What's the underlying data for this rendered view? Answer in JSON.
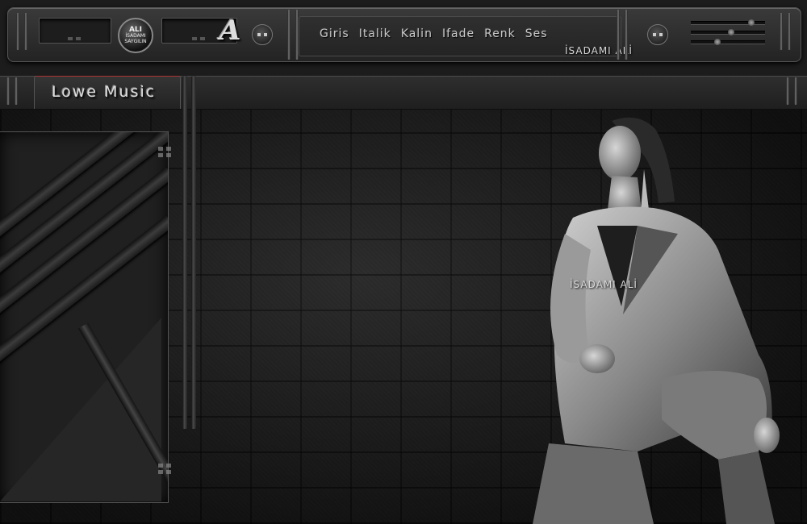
{
  "menu": {
    "items": [
      "Giris",
      "Italik",
      "Kalin",
      "Ifade",
      "Renk",
      "Ses"
    ]
  },
  "logo": {
    "line1": "ALI",
    "line2": "İSADAMI",
    "line3": "SAYGILIN"
  },
  "brand_letter": "A",
  "watermark_text": "İSADAMI ALİ",
  "tab": {
    "label": "Lowe Music"
  },
  "colors": {
    "tab_accent": "#aa3333",
    "background": "#1c1c1c"
  },
  "icons": {
    "display_buttons": "round-dots-icon",
    "sliders": "slider-icon"
  },
  "sliders": {
    "values": [
      0.85,
      0.55,
      0.35
    ]
  }
}
